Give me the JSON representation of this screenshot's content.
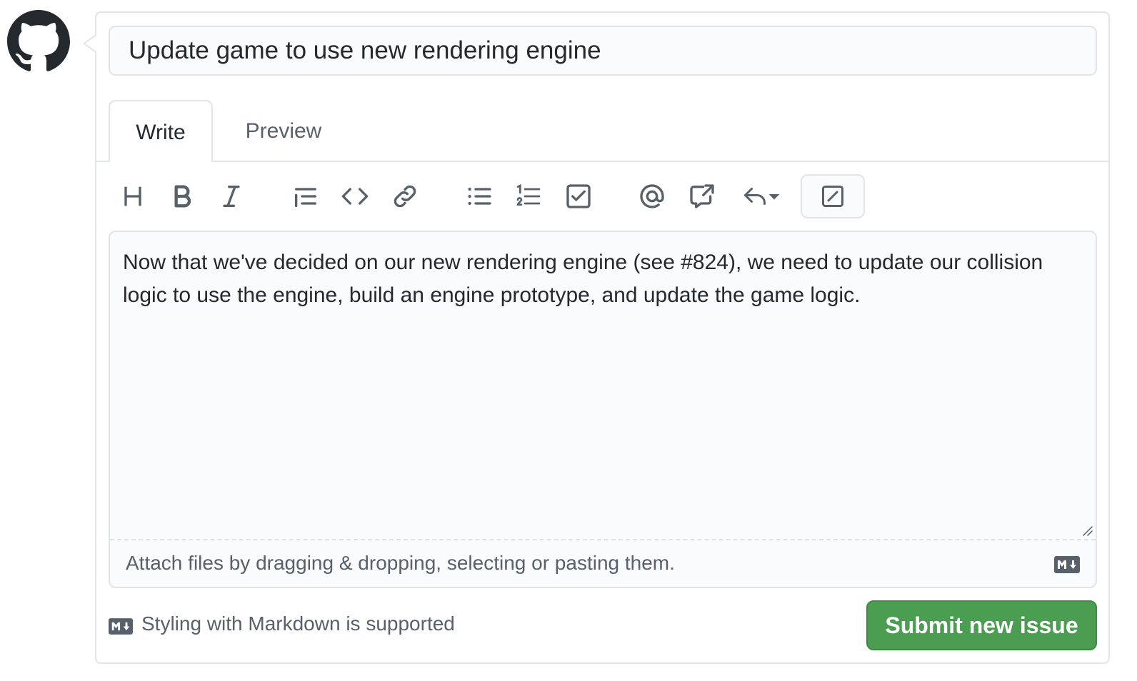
{
  "issue_form": {
    "title_value": "Update game to use new rendering engine",
    "tabs": [
      {
        "label": "Write",
        "active": true
      },
      {
        "label": "Preview",
        "active": false
      }
    ],
    "toolbar": {
      "buttons": [
        "heading-icon",
        "bold-icon",
        "italic-icon",
        "quote-icon",
        "code-icon",
        "link-icon",
        "unordered-list-icon",
        "ordered-list-icon",
        "task-list-icon",
        "mention-icon",
        "cross-reference-icon",
        "reply-icon",
        "diff-ignore-icon"
      ]
    },
    "body_text": "Now that we've decided on our new rendering engine (see #824), we need to update our collision logic to use the engine, build an engine prototype, and update the game logic.",
    "attach_hint": "Attach files by dragging & dropping, selecting or pasting them.",
    "footer_hint": "Styling with Markdown is supported",
    "submit_label": "Submit new issue"
  },
  "colors": {
    "border": "#e1e4e8",
    "input_bg": "#fafbfc",
    "text": "#24292e",
    "muted": "#586069",
    "submit_bg": "#4b9e51"
  }
}
